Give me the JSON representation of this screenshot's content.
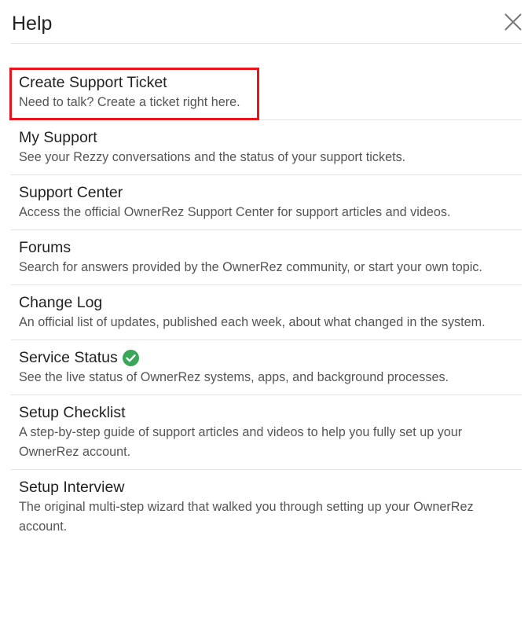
{
  "header": {
    "title": "Help",
    "close_icon": "close-icon"
  },
  "colors": {
    "highlight_border": "#e8141c",
    "status_ok": "#3aa65a",
    "divider": "#e2e2e2",
    "title_text": "#222222",
    "desc_text": "#555555"
  },
  "items": [
    {
      "title": "Create Support Ticket",
      "description": "Need to talk? Create a ticket right here.",
      "highlighted": true
    },
    {
      "title": "My Support",
      "description": "See your Rezzy conversations and the status of your support tickets."
    },
    {
      "title": "Support Center",
      "description": "Access the official OwnerRez Support Center for support articles and videos."
    },
    {
      "title": "Forums",
      "description": "Search for answers provided by the OwnerRez community, or start your own topic."
    },
    {
      "title": "Change Log",
      "description": "An official list of updates, published each week, about what changed in the system."
    },
    {
      "title": "Service Status",
      "description": "See the live status of OwnerRez systems, apps, and background processes.",
      "status_icon": "check-circle-icon"
    },
    {
      "title": "Setup Checklist",
      "description": "A step-by-step guide of support articles and videos to help you fully set up your OwnerRez account."
    },
    {
      "title": "Setup Interview",
      "description": "The original multi-step wizard that walked you through setting up your OwnerRez account."
    }
  ]
}
